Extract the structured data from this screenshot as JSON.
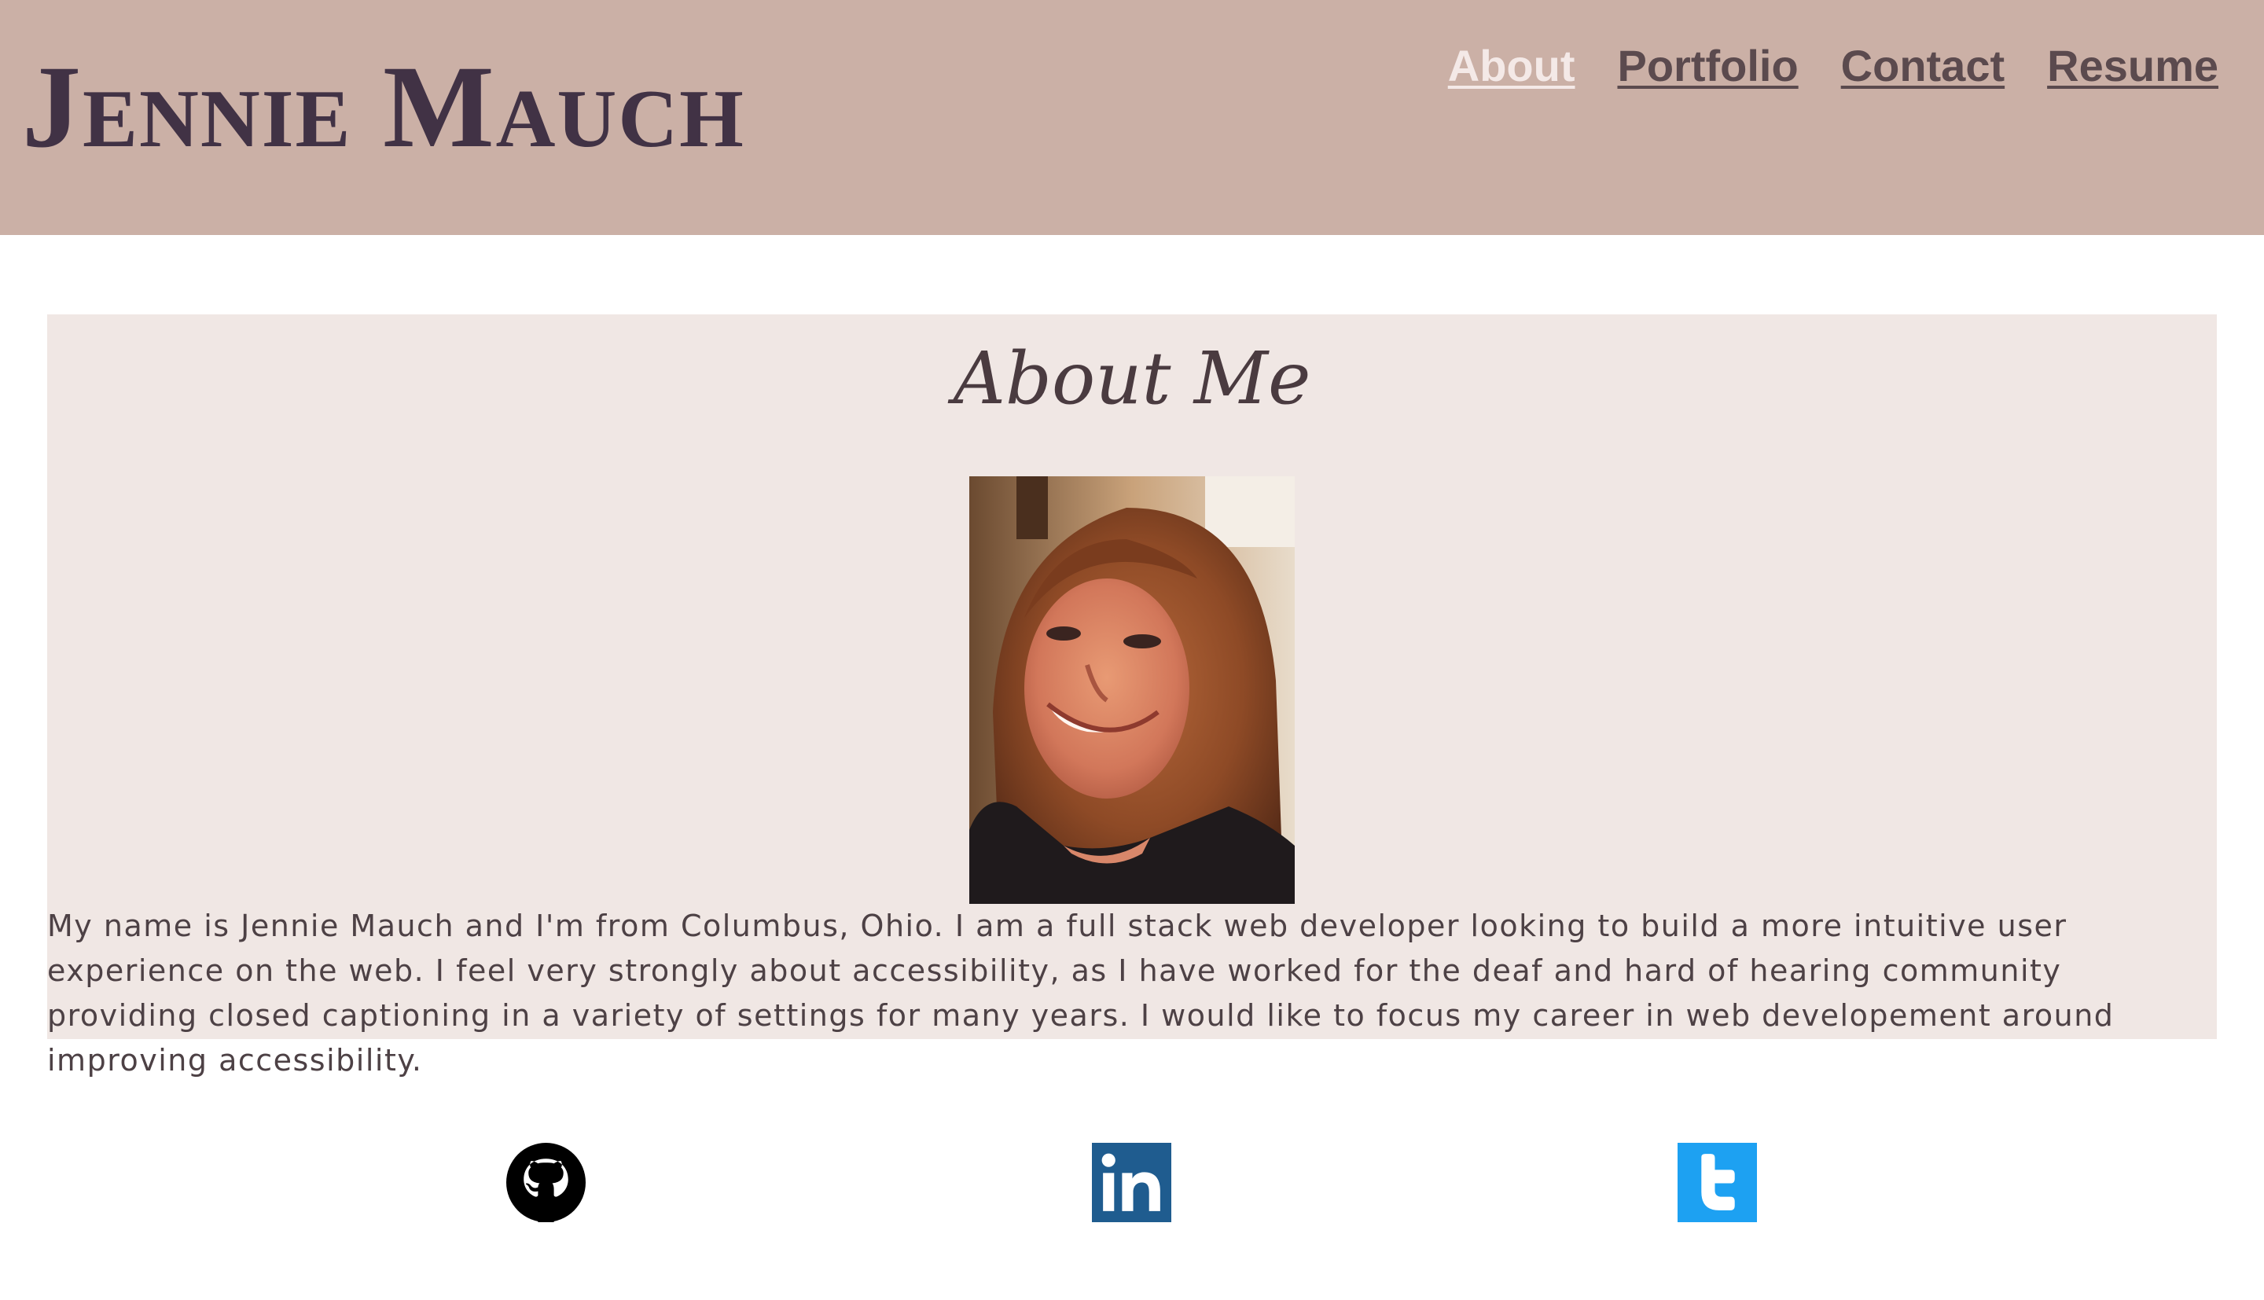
{
  "header": {
    "title": "Jennie Mauch",
    "nav": [
      {
        "label": "About",
        "active": true
      },
      {
        "label": "Portfolio",
        "active": false
      },
      {
        "label": "Contact",
        "active": false
      },
      {
        "label": "Resume",
        "active": false
      }
    ]
  },
  "about": {
    "heading": "About Me",
    "photo_icon": "profile-photo",
    "bio": "My name is Jennie Mauch and I'm from Columbus, Ohio. I am a full stack web developer looking to build a more intuitive user experience on the web. I feel very strongly about accessibility, as I have worked for the deaf and hard of hearing community providing closed captioning in a variety of settings for many years. I would like to focus my career in web developement around improving accessibility."
  },
  "social": [
    {
      "icon": "github-icon",
      "color": "#000000"
    },
    {
      "icon": "linkedin-icon",
      "color": "#1f5c8f"
    },
    {
      "icon": "twitter-icon",
      "color": "#1da1f2"
    }
  ],
  "colors": {
    "header_bg": "#cbb0a6",
    "title": "#413245",
    "nav_link": "#5b4a4e",
    "nav_active": "#f4e9e7",
    "card_bg": "#f0e7e4",
    "text": "#4d4145"
  }
}
